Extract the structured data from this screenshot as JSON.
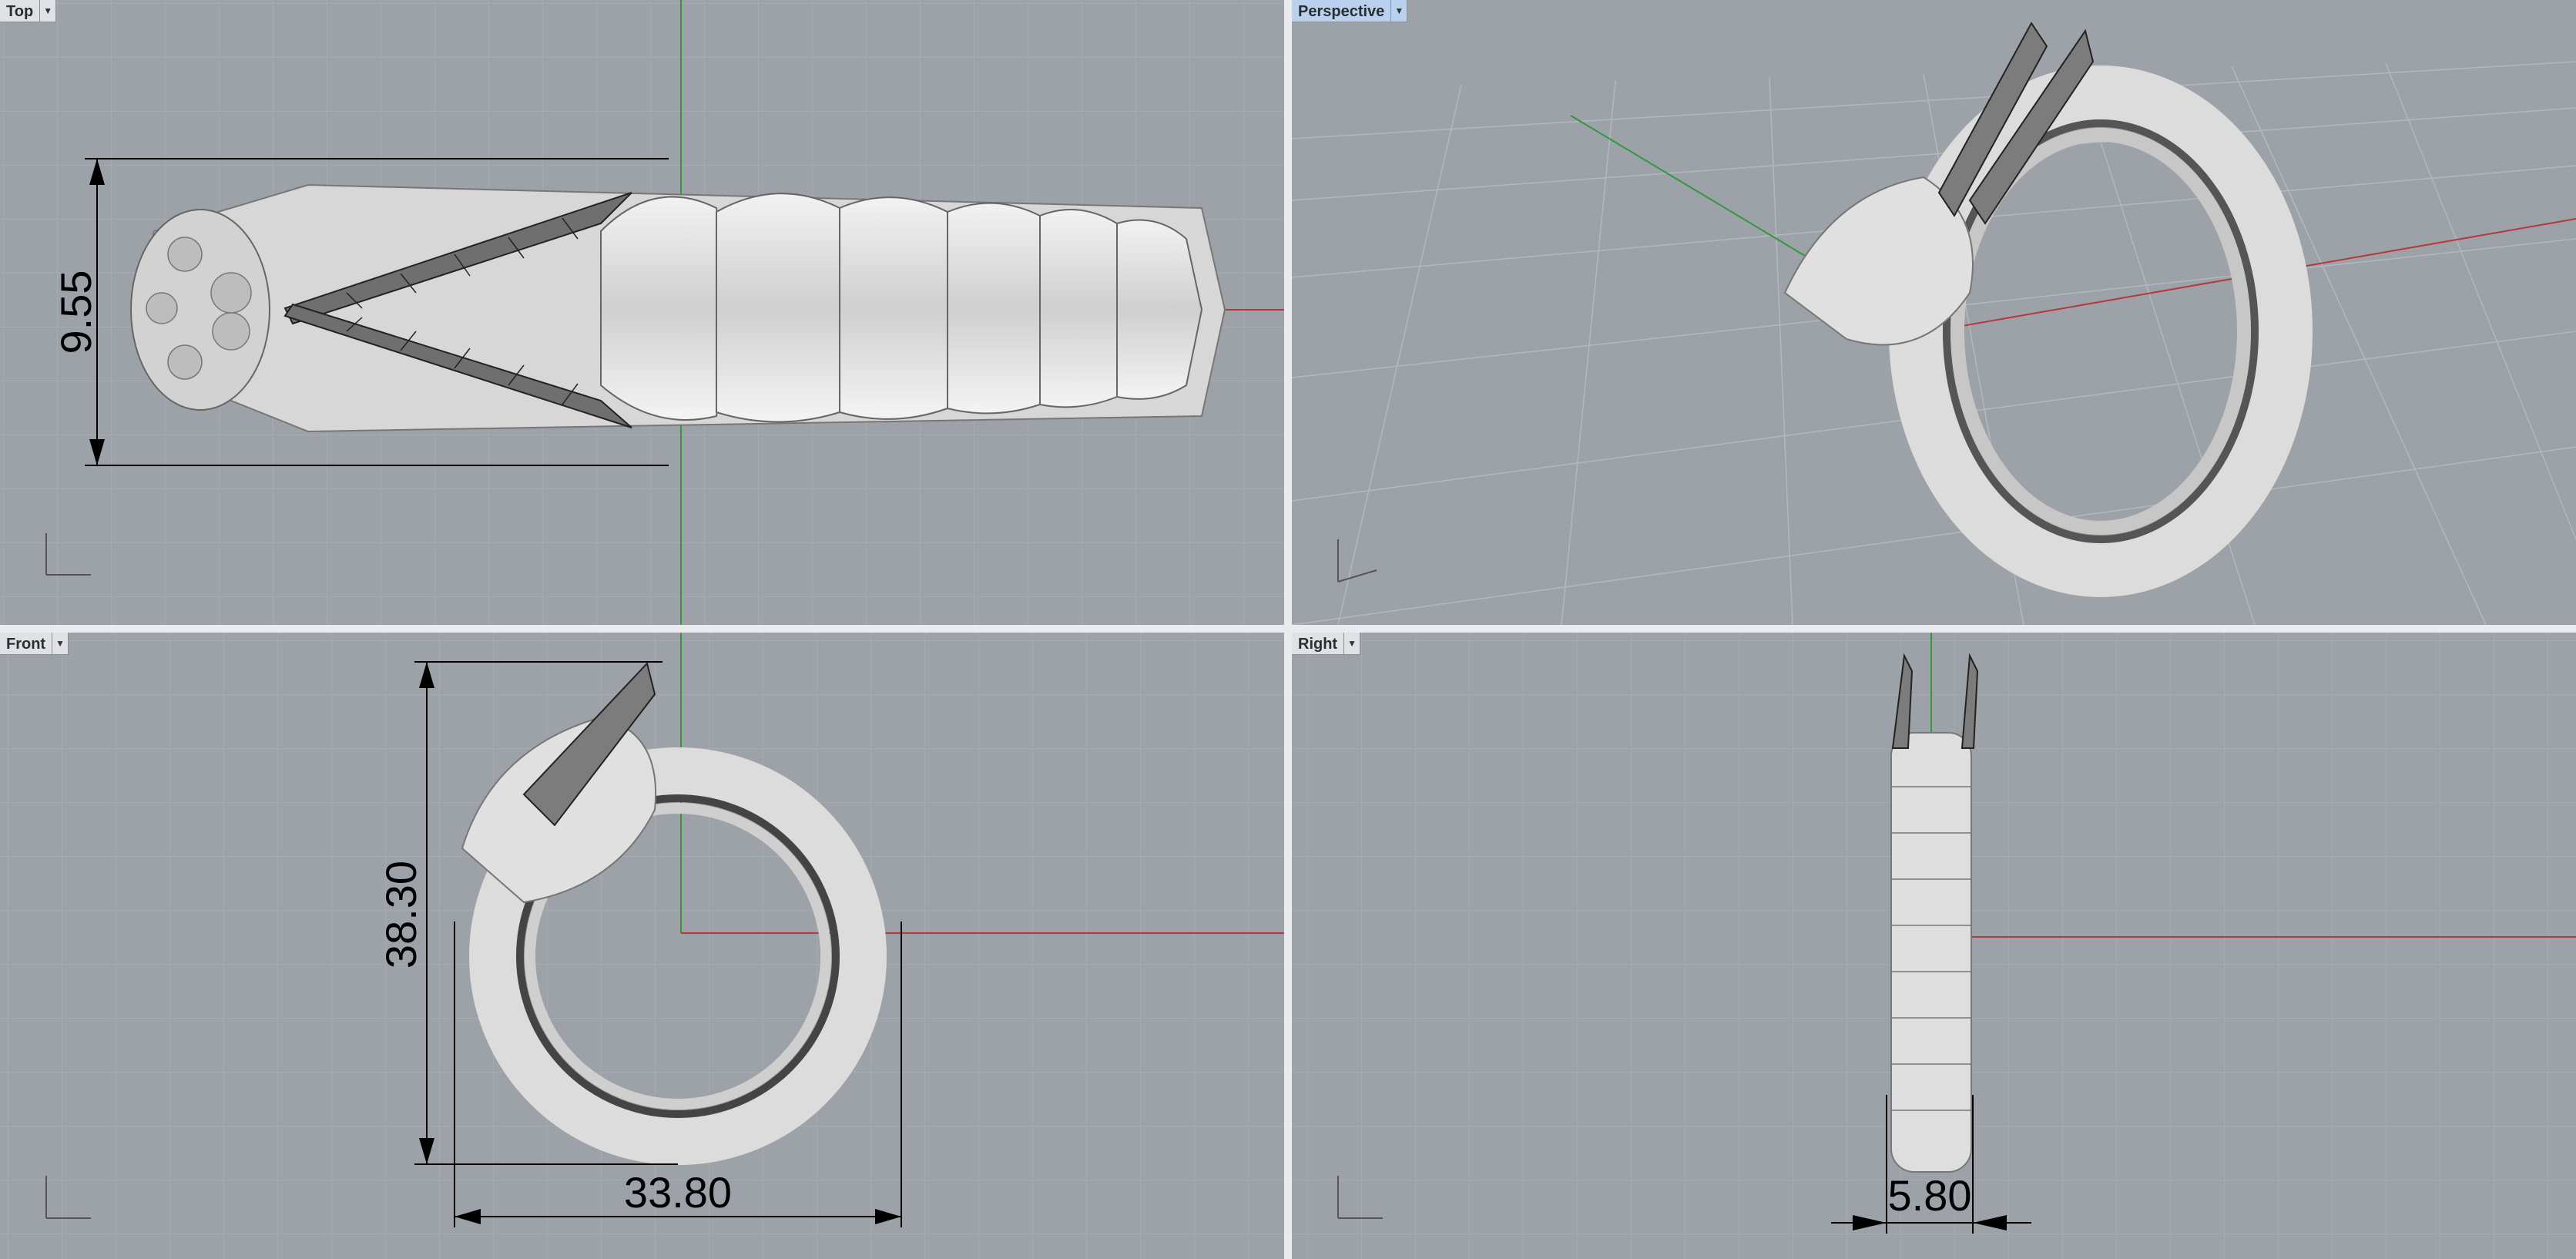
{
  "viewports": {
    "top": {
      "label": "Top",
      "dimension": "9.55"
    },
    "perspective": {
      "label": "Perspective"
    },
    "front": {
      "label": "Front",
      "dimension_height": "38.30",
      "dimension_width": "33.80"
    },
    "right": {
      "label": "Right",
      "dimension": "5.80"
    }
  },
  "icons": {
    "viewport_menu": "dropdown-arrow-icon"
  },
  "colors": {
    "viewport_bg": "#9da2a9",
    "grid_minor": "#a8adb4",
    "grid_major": "#8d9299",
    "x_axis": "#b23a3a",
    "y_axis": "#2e9a3a",
    "active_tab": "#b9d1ee",
    "model": "#e8e8e8"
  }
}
